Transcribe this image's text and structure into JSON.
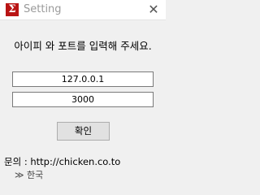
{
  "window": {
    "title": "Setting",
    "app_icon_glyph": "Σ",
    "close_glyph": "✕"
  },
  "prompt": "아이피 와 포트를 입력해 주세요.",
  "fields": {
    "ip_value": "127.0.0.1",
    "port_value": "3000"
  },
  "confirm_label": "확인",
  "contact": "문의 : http://chicken.co.to",
  "underlay_text": "≫ 한국"
}
